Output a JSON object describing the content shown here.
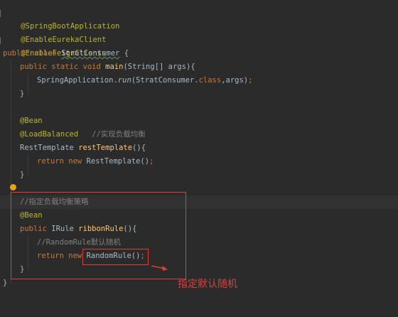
{
  "code": {
    "l1": "@SpringBootApplication",
    "l2": "@EnableEurekaClient",
    "l3": "@EnableFeignClients",
    "l4_kw1": "public",
    "l4_kw2": "class",
    "l4_name": "StratConsumer",
    "l4_rest": " {",
    "l5_kw1": "public",
    "l5_kw2": "static",
    "l5_kw3": "void",
    "l5_fn": "main",
    "l5_rest": "(String[] args){",
    "l6_a": "SpringApplication.",
    "l6_call": "run",
    "l6_b": "(StratConsumer.",
    "l6_kw": "class",
    "l6_c": ",args)",
    "l6_semi": ";",
    "l7": "}",
    "l9": "@Bean",
    "l10_ann": "@LoadBalanced",
    "l10_cm": "   //实现负载均衡",
    "l11_type": "RestTemplate ",
    "l11_fn": "restTemplate",
    "l11_rest": "(){",
    "l12_kw1": "return",
    "l12_kw2": "new",
    "l12_rest": " RestTemplate()",
    "l12_semi": ";",
    "l13": "}",
    "l15_cm": "//指定负载均衡策略",
    "l16": "@Bean",
    "l17_kw": "public",
    "l17_type": " IRule ",
    "l17_fn": "ribbonRule",
    "l17_rest": "(){",
    "l18_cm": "//RandomRule默认随机",
    "l19_kw1": "return",
    "l19_kw2": "new",
    "l19_rest": "RandomRule()",
    "l19_semi": ";",
    "l20": "}",
    "l21": "}"
  },
  "annotation_note": "指定默认随机",
  "colors": {
    "background": "#2b2b2b",
    "keyword": "#cc7832",
    "annotation": "#bbb529",
    "method": "#ffc66d",
    "comment": "#808080",
    "highlight_red": "#e23c3c"
  }
}
